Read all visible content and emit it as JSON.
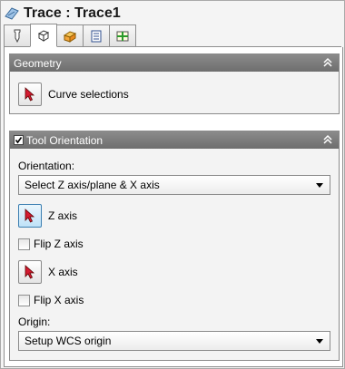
{
  "window": {
    "title": "Trace : Trace1"
  },
  "tabs": [
    {
      "icon": "tool-icon"
    },
    {
      "icon": "cube-icon",
      "active": true
    },
    {
      "icon": "stock-icon"
    },
    {
      "icon": "list-icon"
    },
    {
      "icon": "linking-icon"
    }
  ],
  "geometry": {
    "header": "Geometry",
    "curve_selections_label": "Curve selections"
  },
  "tool_orientation": {
    "header": "Tool Orientation",
    "enabled": true,
    "orientation_label": "Orientation:",
    "orientation_value": "Select Z axis/plane & X axis",
    "z_axis_label": "Z axis",
    "flip_z_label": "Flip Z axis",
    "flip_z_checked": false,
    "x_axis_label": "X axis",
    "flip_x_label": "Flip X axis",
    "flip_x_checked": false,
    "origin_label": "Origin:",
    "origin_value": "Setup WCS origin"
  },
  "colors": {
    "header_bg": "#7c7c7c",
    "pick_arrow": "#c0182a",
    "pick_active": "#bfe2f8"
  }
}
